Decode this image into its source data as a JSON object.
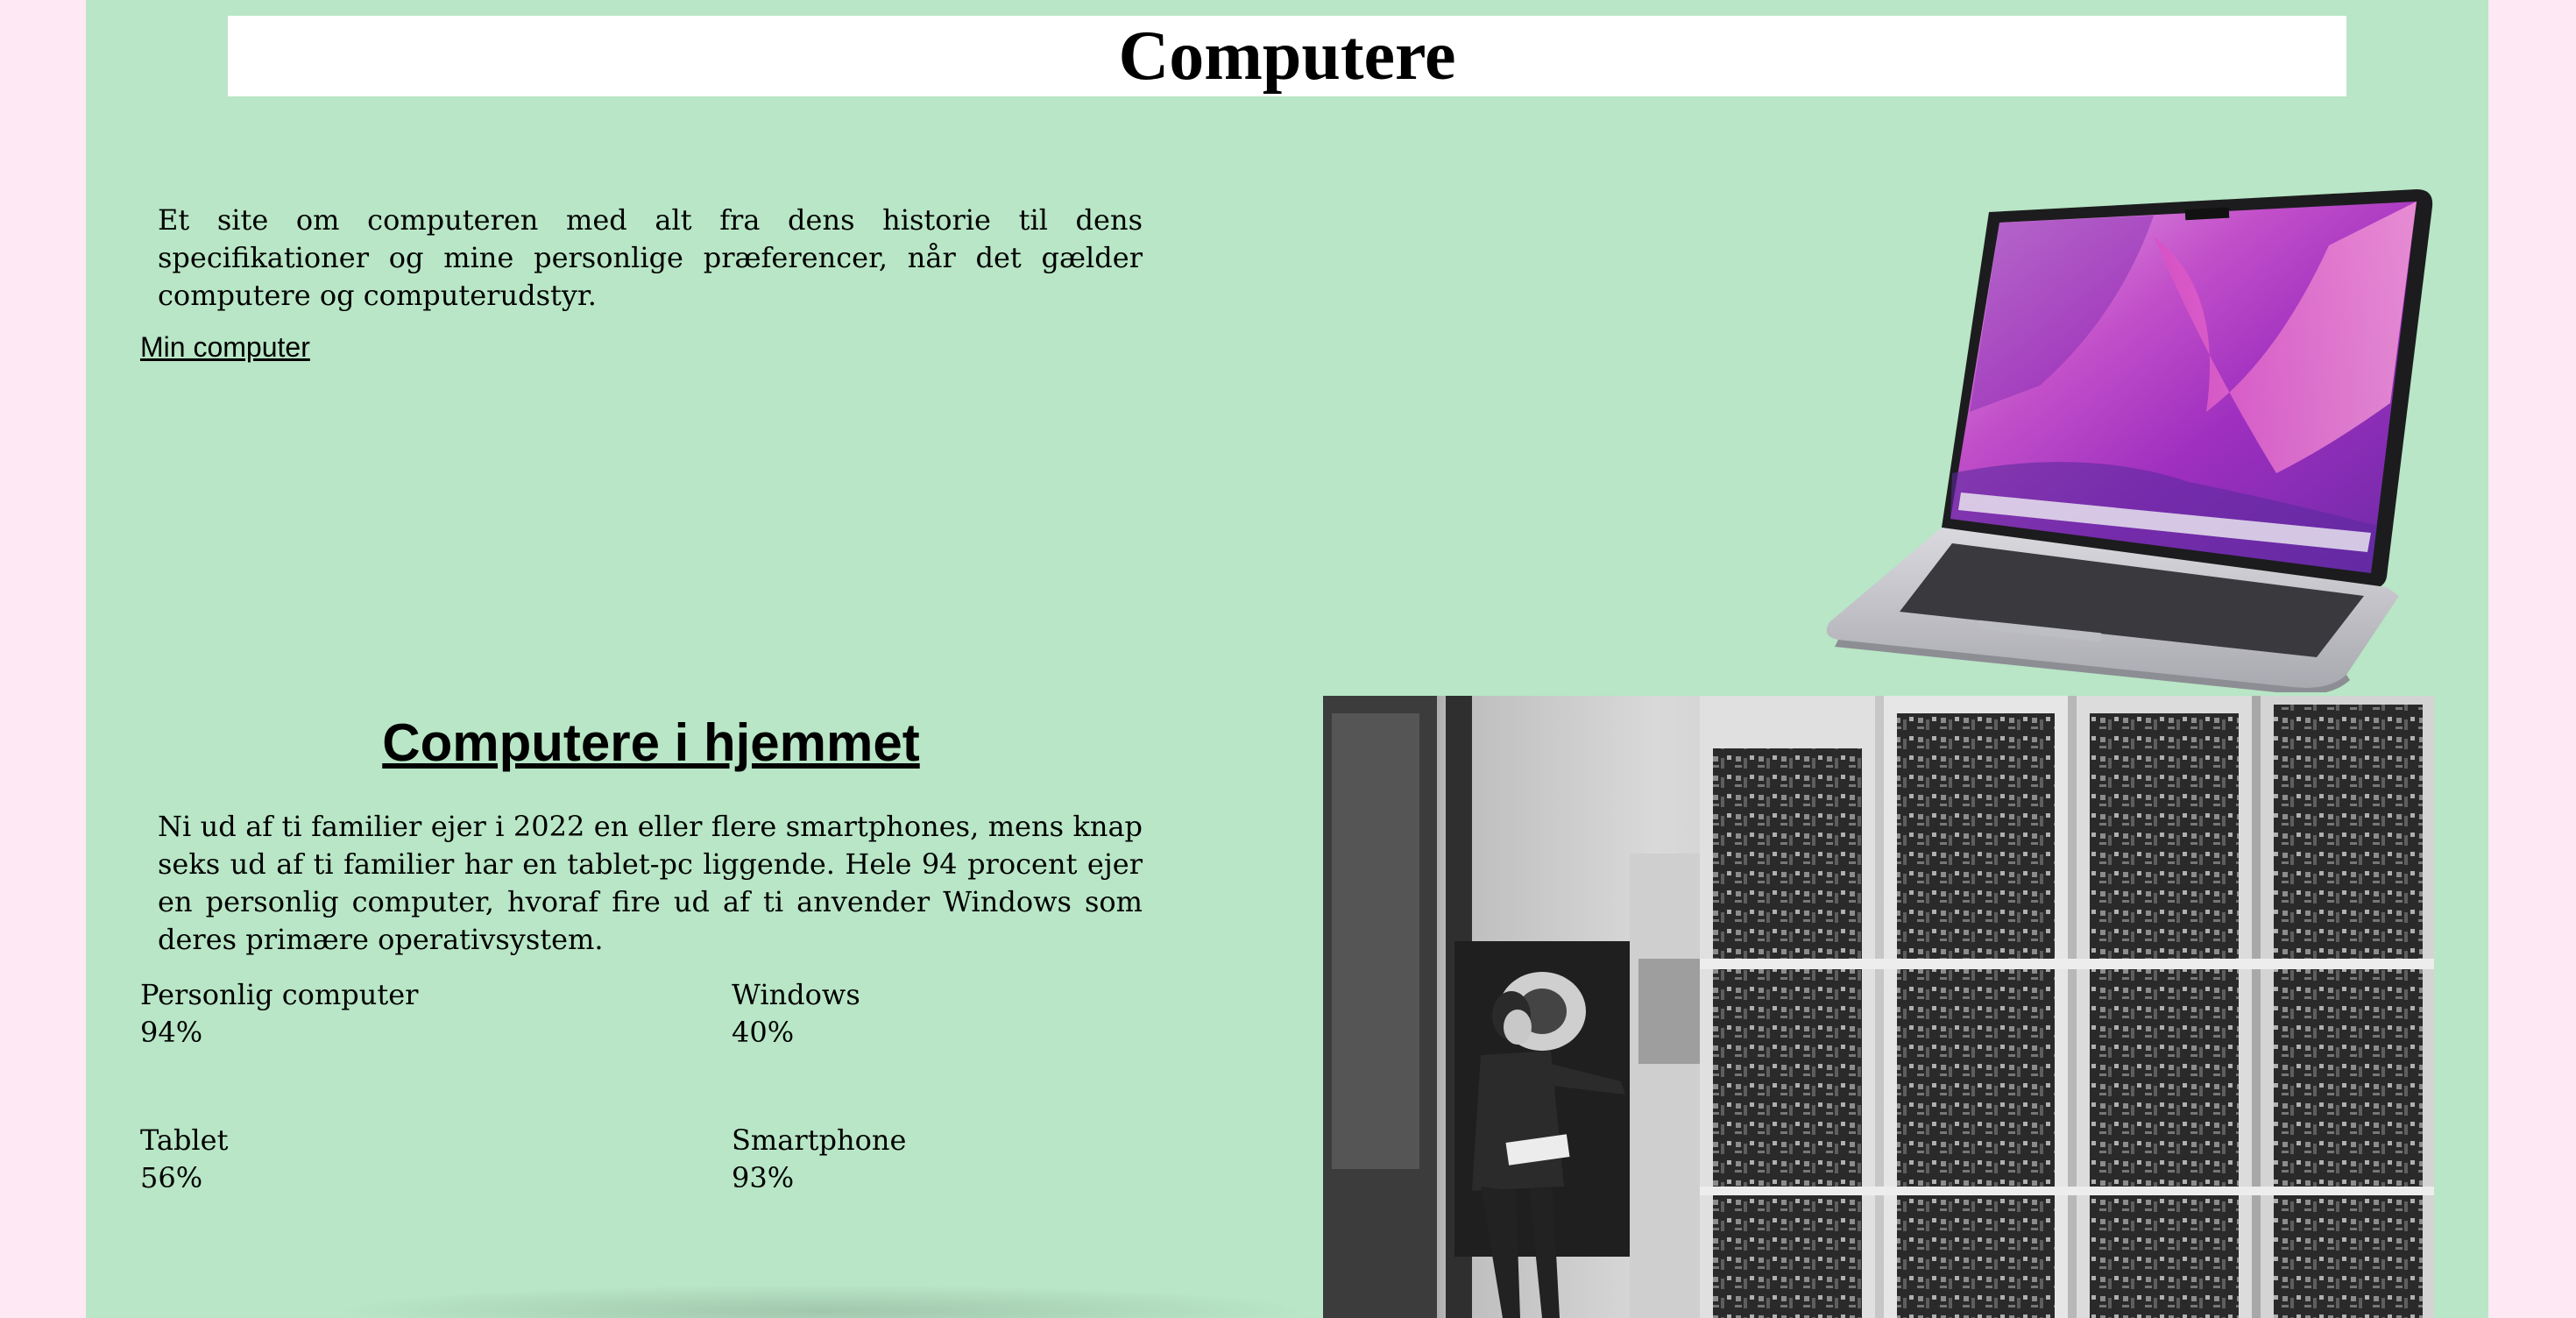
{
  "header": {
    "title": "Computere"
  },
  "intro": {
    "text": "Et site om computeren med alt fra dens historie til dens specifikationer og mine personlige præferencer, når det gælder computere og computerudstyr.",
    "link_label": "Min computer"
  },
  "section": {
    "title": "Computere i hjemmet",
    "text": "Ni ud af ti familier ejer i 2022 en eller flere smartphones, mens knap seks ud af ti familier har en tablet-pc liggende. Hele 94 procent ejer en personlig computer, hvoraf fire ud af ti anvender Windows som deres primære operativsystem."
  },
  "stats": [
    {
      "label": "Personlig computer",
      "value": "94%"
    },
    {
      "label": "Windows",
      "value": "40%"
    },
    {
      "label": "Tablet",
      "value": "56%"
    },
    {
      "label": "Smartphone",
      "value": "93%"
    }
  ],
  "images": {
    "laptop": "laptop-image",
    "mainframe": "mainframe-photo"
  },
  "colors": {
    "page_background": "#fde8f3",
    "content_background": "#b8e6c6",
    "header_background": "#ffffff"
  }
}
